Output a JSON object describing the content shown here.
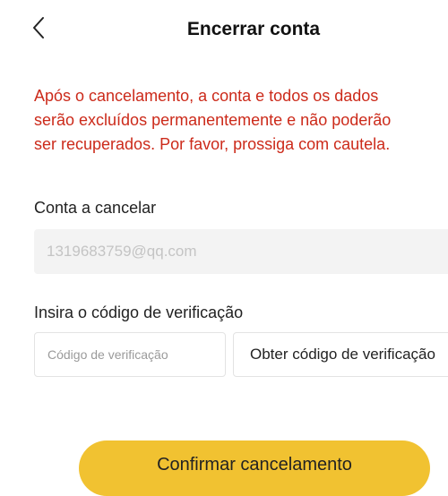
{
  "header": {
    "back_icon": "chevron-left-icon",
    "title": "Encerrar conta"
  },
  "warning": {
    "line1": "Após o cancelamento, a conta e todos os dados",
    "line2": "serão excluídos permanentemente e não poderão",
    "line3": "ser recuperados. Por favor, prossiga com cautela.",
    "color": "#cc2a1a"
  },
  "account": {
    "label": "Conta a cancelar",
    "value": "1319683759@qq.com"
  },
  "verification": {
    "label": "Insira o código de verificação",
    "placeholder": "Código de verificação",
    "get_code_label": "Obter código de verificação"
  },
  "confirm": {
    "label": "Confirmar cancelamento",
    "color": "#f1c231"
  }
}
